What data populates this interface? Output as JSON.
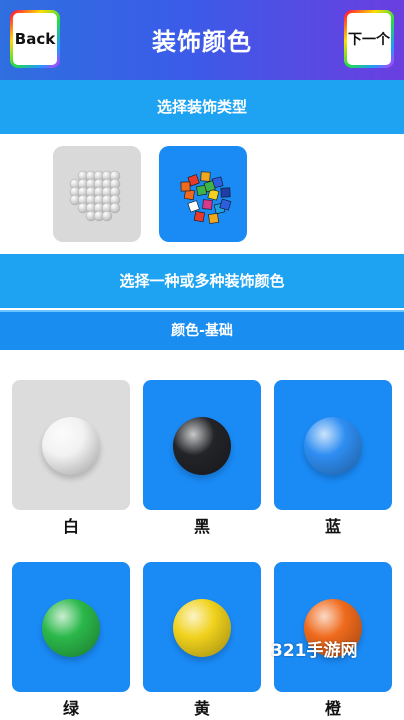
{
  "header": {
    "back_label": "Back",
    "title": "装饰颜色",
    "next_label": "下一个"
  },
  "sections": {
    "type_header": "选择装饰类型",
    "color_header": "选择一种或多种装饰颜色",
    "category_header": "颜色-基础"
  },
  "decoration_types": [
    {
      "icon": "beads-icon",
      "selected": false
    },
    {
      "icon": "cubes-icon",
      "selected": true
    }
  ],
  "colors": [
    {
      "label": "白",
      "color": "#f2f2f2",
      "selected": true
    },
    {
      "label": "黑",
      "color": "#222428",
      "selected": false
    },
    {
      "label": "蓝",
      "color": "#2f8ef2",
      "selected": false
    },
    {
      "label": "绿",
      "color": "#2bb84a",
      "selected": false
    },
    {
      "label": "黄",
      "color": "#f0d21c",
      "selected": false
    },
    {
      "label": "橙",
      "color": "#ef6a1c",
      "selected": false
    }
  ],
  "watermark": "321手游网"
}
